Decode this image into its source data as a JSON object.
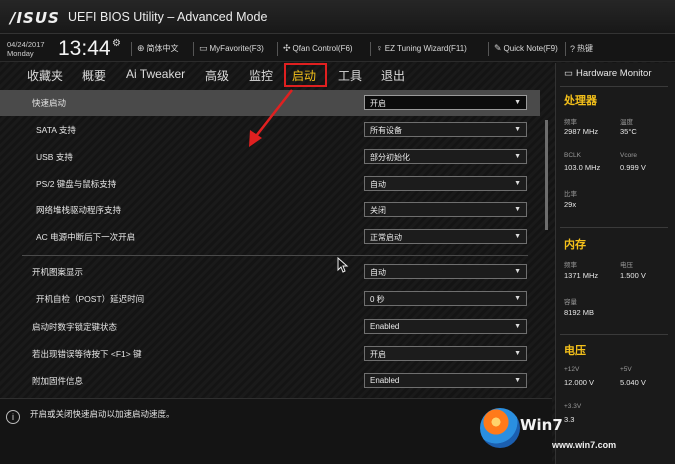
{
  "header": {
    "logo": "/ISUS",
    "title": "UEFI BIOS Utility – Advanced Mode",
    "date": "04/24/2017",
    "day": "Monday",
    "time": "13:44",
    "tools": [
      {
        "label": "简体中文",
        "icon": "globe-icon"
      },
      {
        "label": "MyFavorite(F3)",
        "icon": "favorite-icon"
      },
      {
        "label": "Qfan Control(F6)",
        "icon": "fan-icon"
      },
      {
        "label": "EZ Tuning Wizard(F11)",
        "icon": "bulb-icon"
      },
      {
        "label": "Quick Note(F9)",
        "icon": "note-icon"
      },
      {
        "label": "热键",
        "icon": "help-icon"
      }
    ]
  },
  "tabs": [
    {
      "label": "收藏夹"
    },
    {
      "label": "概要"
    },
    {
      "label": "Ai Tweaker"
    },
    {
      "label": "高级"
    },
    {
      "label": "监控"
    },
    {
      "label": "启动",
      "active": true
    },
    {
      "label": "工具"
    },
    {
      "label": "退出"
    }
  ],
  "settings": [
    {
      "label": "快速启动",
      "value": "开启"
    },
    {
      "label": "SATA 支持",
      "value": "所有设备"
    },
    {
      "label": "USB 支持",
      "value": "部分初始化"
    },
    {
      "label": "PS/2 键盘与鼠标支持",
      "value": "自动"
    },
    {
      "label": "网络堆栈驱动程序支持",
      "value": "关闭"
    },
    {
      "label": "AC 电源中断后下一次开启",
      "value": "正常启动"
    },
    {
      "label": "开机图案显示",
      "value": "自动"
    },
    {
      "label": "开机自检（POST）延迟时间",
      "value": "0 秒"
    },
    {
      "label": "启动时数字锁定键状态",
      "value": "Enabled"
    },
    {
      "label": "若出现错误等待按下 <F1> 键",
      "value": "开启"
    },
    {
      "label": "附加固件信息",
      "value": "Enabled"
    }
  ],
  "status_text": "开启或关闭快速启动以加速启动速度。",
  "hardware_monitor": {
    "title": "Hardware Monitor",
    "cpu": {
      "heading": "处理器",
      "freq_label": "频率",
      "freq_value": "2987 MHz",
      "temp_label": "温度",
      "temp_value": "35°C",
      "bclk_label": "BCLK",
      "bclk_value": "103.0 MHz",
      "vcore_label": "Vcore",
      "vcore_value": "0.999 V",
      "ratio_label": "比率",
      "ratio_value": "29x"
    },
    "memory": {
      "heading": "内存",
      "freq_label": "频率",
      "freq_value": "1371 MHz",
      "volt_label": "电压",
      "volt_value": "1.500 V",
      "cap_label": "容量",
      "cap_value": "8192 MB"
    },
    "voltage": {
      "heading": "电压",
      "v12_label": "+12V",
      "v12_value": "12.000 V",
      "v5_label": "+5V",
      "v5_value": "5.040 V",
      "v33_label": "+3.3V",
      "v33_value": "3.3"
    }
  },
  "watermark": {
    "brand": "Win7",
    "url": "www.win7.com"
  },
  "colors": {
    "accent": "#f4c01a",
    "highlight_box": "#e02020",
    "annotation_arrow": "#e02020"
  }
}
